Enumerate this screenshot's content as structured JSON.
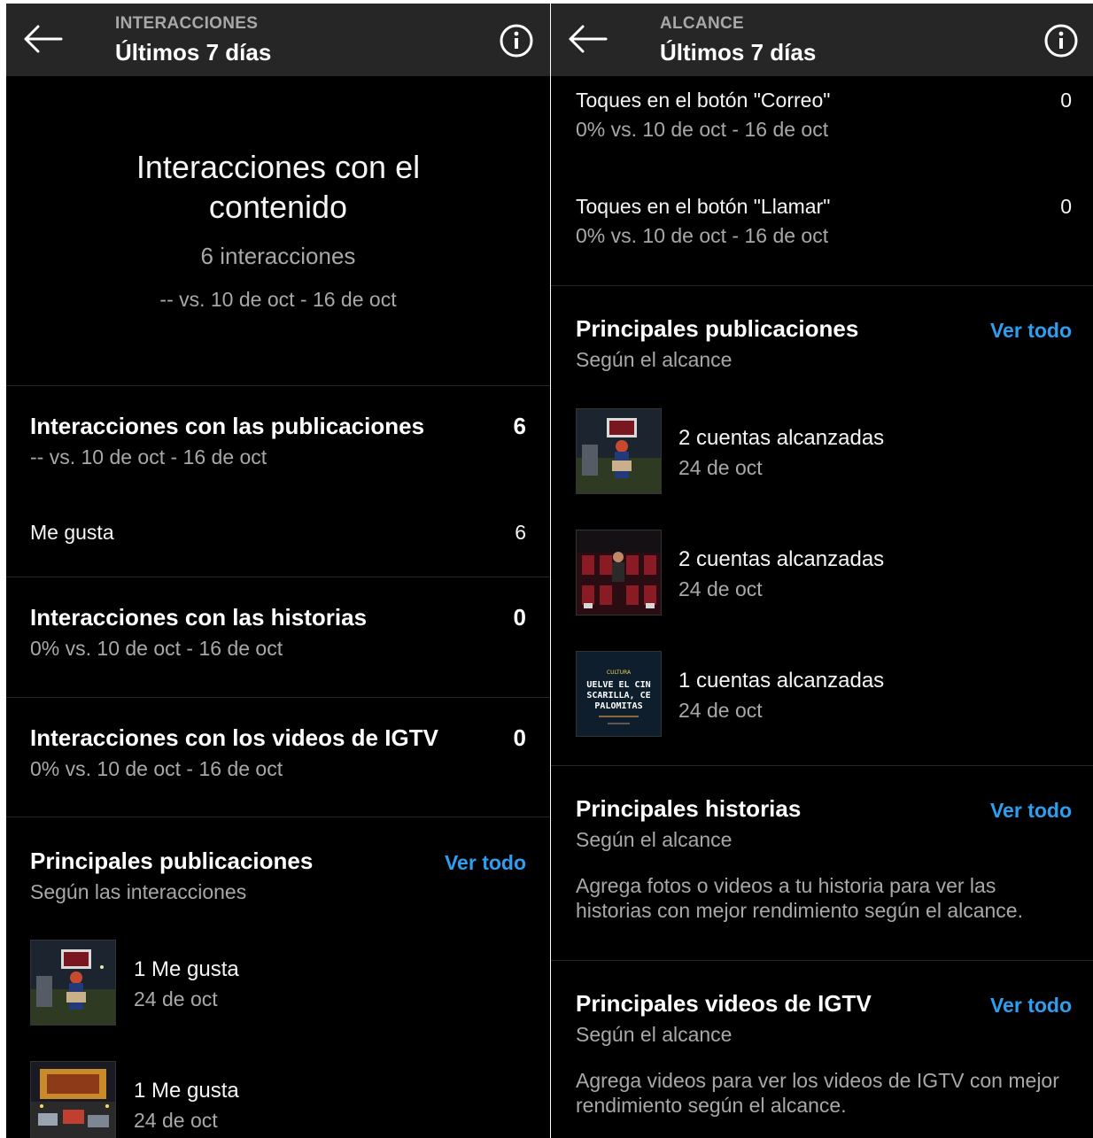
{
  "left": {
    "header": {
      "section": "INTERACCIONES",
      "title": "Últimos 7 días"
    },
    "hero": {
      "title_line1": "Interacciones con el",
      "title_line2": "contenido",
      "count": "6 interacciones",
      "comparison": "-- vs. 10 de oct - 16 de oct"
    },
    "rows": [
      {
        "title": "Interacciones con las publicaciones",
        "value": "6",
        "sub": "-- vs. 10 de oct - 16 de oct"
      },
      {
        "title": "Interacciones con las historias",
        "value": "0",
        "sub": "0% vs. 10 de oct - 16 de oct"
      },
      {
        "title": "Interacciones con los videos de IGTV",
        "value": "0",
        "sub": "0% vs. 10 de oct - 16 de oct"
      }
    ],
    "likes": {
      "label": "Me gusta",
      "value": "6"
    },
    "top_posts": {
      "title": "Principales publicaciones",
      "subtitle": "Según las interacciones",
      "link": "Ver todo",
      "items": [
        {
          "main": "1 Me gusta",
          "date": "24 de oct"
        },
        {
          "main": "1 Me gusta",
          "date": "24 de oct"
        }
      ]
    }
  },
  "right": {
    "header": {
      "section": "ALCANCE",
      "title": "Últimos 7 días"
    },
    "taps": [
      {
        "title": "Toques en el botón \"Correo\"",
        "value": "0",
        "sub": "0% vs. 10 de oct - 16 de oct"
      },
      {
        "title": "Toques en el botón \"Llamar\"",
        "value": "0",
        "sub": "0% vs. 10 de oct - 16 de oct"
      }
    ],
    "top_posts": {
      "title": "Principales publicaciones",
      "subtitle": "Según el alcance",
      "link": "Ver todo",
      "items": [
        {
          "main": "2 cuentas alcanzadas",
          "date": "24 de oct"
        },
        {
          "main": "2 cuentas alcanzadas",
          "date": "24 de oct"
        },
        {
          "main": "1 cuentas alcanzadas",
          "date": "24 de oct"
        }
      ],
      "thumb3_text": {
        "tag": "CULTURA",
        "line1": "UELVE EL CIN",
        "line2": "SCARILLA, CE",
        "line3": "PALOMITAS"
      }
    },
    "top_stories": {
      "title": "Principales historias",
      "subtitle": "Según el alcance",
      "link": "Ver todo",
      "empty_line1": "Agrega fotos o videos a tu historia para ver las",
      "empty_line2": "historias con mejor rendimiento según el alcance."
    },
    "top_igtv": {
      "title": "Principales videos de IGTV",
      "subtitle": "Según el alcance",
      "link": "Ver todo",
      "empty_line1": "Agrega videos para ver los videos de IGTV con mejor",
      "empty_line2": "rendimiento según el alcance."
    }
  },
  "colors": {
    "background": "#000000",
    "header": "#262626",
    "link": "#2d9ff0",
    "secondary_text": "#a8a8a8"
  },
  "icons": {
    "back": "arrow-left-icon",
    "info": "info-circle-icon"
  }
}
